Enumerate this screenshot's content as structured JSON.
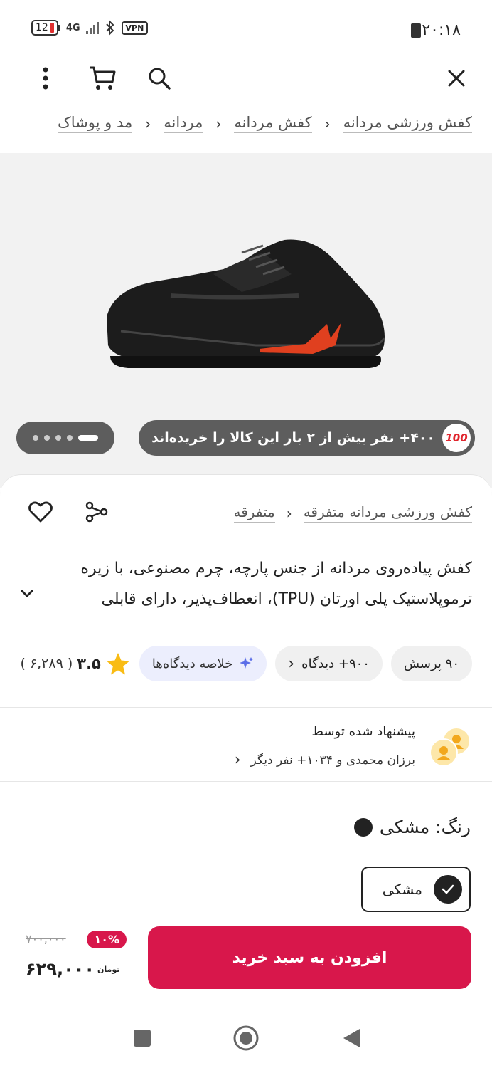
{
  "status_bar": {
    "time": "۲۰:۱۸",
    "battery": "12",
    "network": "4G",
    "vpn": "VPN"
  },
  "toolbar": {
    "icons": [
      "close-icon",
      "search-icon",
      "cart-icon",
      "more-vertical-icon"
    ]
  },
  "breadcrumb": [
    "مد و پوشاک",
    "مردانه",
    "کفش مردانه",
    "کفش ورزشی مردانه"
  ],
  "gallery": {
    "purchase_note": "۴۰۰+ نفر بیش از ۲ بار این کالا را خریده‌اند",
    "badge": "100",
    "dots_count": 5
  },
  "product": {
    "breadcrumb": [
      "متفرقه",
      "کفش ورزشی مردانه متفرقه"
    ],
    "title_line1": "کفش پیاده‌روی مردانه از جنس پارچه، چرم مصنوعی، با زیره",
    "title_line2": "ترموپلاستیک پلی اورتان (TPU)، انعطاف‌پذیر، دارای قابلی",
    "rating": "۳.۵",
    "rating_count": "( ۶,۲۸۹ )",
    "review_summary": "خلاصه دیدگاه‌ها",
    "reviews": "۹۰۰+ دیدگاه",
    "questions": "۹۰ پرسش"
  },
  "recommend": {
    "title": "پیشنهاد شده توسط",
    "subtitle": "برزان محمدی و ۱۰۳۴+ نفر دیگر"
  },
  "color": {
    "label": "رنگ: مشکی",
    "option": "مشکی",
    "swatch": "#222222"
  },
  "purchase": {
    "old_price": "۷۰۰,۰۰۰",
    "discount": "۱۰%",
    "price": "۶۲۹,۰۰۰",
    "currency": "تومان",
    "add_to_cart": "افزودن به سبد خرید",
    "accent": "#d8174b"
  },
  "nav": {
    "icons": [
      "recent-apps-icon",
      "home-icon",
      "back-icon"
    ]
  }
}
